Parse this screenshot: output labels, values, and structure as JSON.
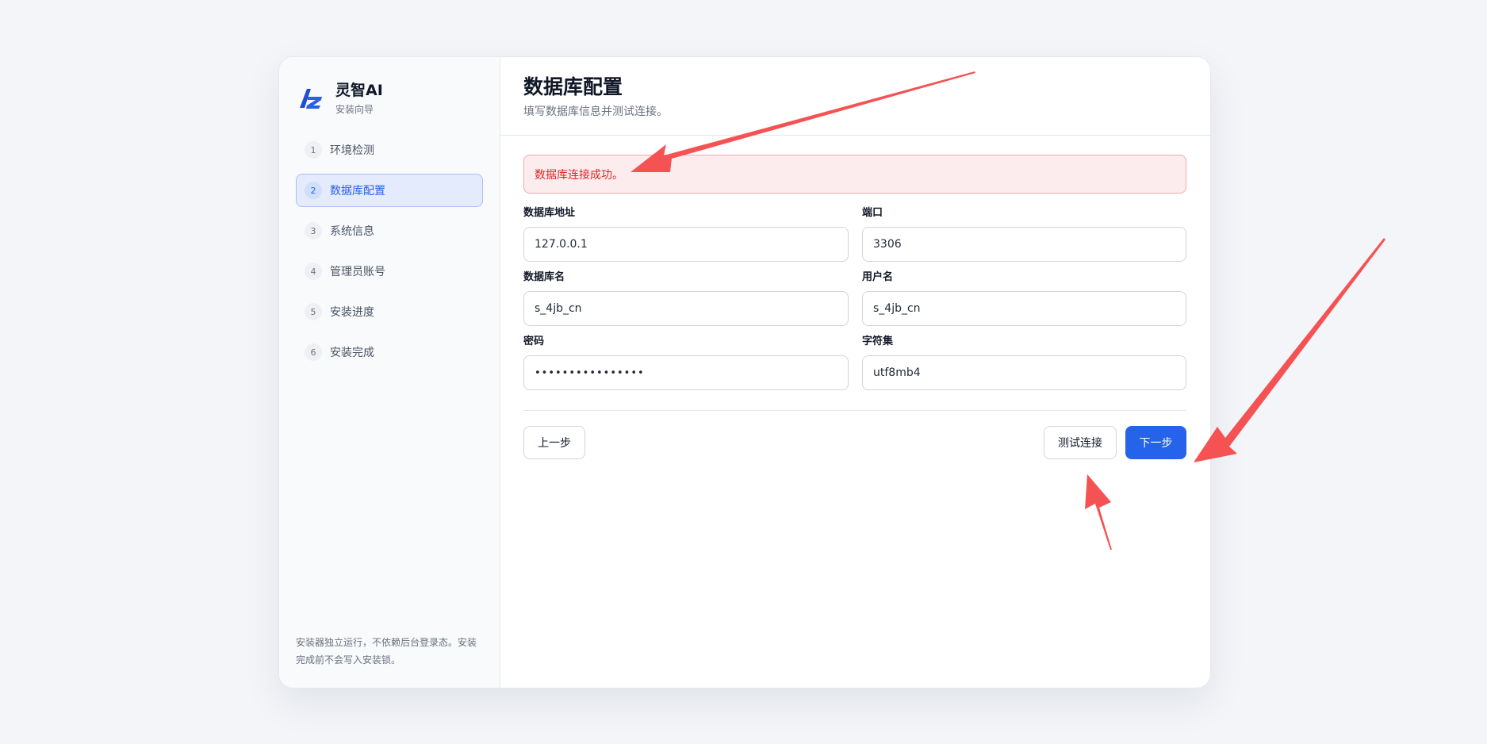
{
  "brand": {
    "name": "灵智AI",
    "subtitle": "安装向导",
    "logo_icon": "lz-logo-icon",
    "accent_color": "#2563eb"
  },
  "steps": [
    {
      "num": "1",
      "label": "环境检测"
    },
    {
      "num": "2",
      "label": "数据库配置"
    },
    {
      "num": "3",
      "label": "系统信息"
    },
    {
      "num": "4",
      "label": "管理员账号"
    },
    {
      "num": "5",
      "label": "安装进度"
    },
    {
      "num": "6",
      "label": "安装完成"
    }
  ],
  "sidebar_note": "安装器独立运行，不依赖后台登录态。安装完成前不会写入安装锁。",
  "header": {
    "title": "数据库配置",
    "subtitle": "填写数据库信息并测试连接。"
  },
  "alert": {
    "text": "数据库连接成功。",
    "color": "#dc2626"
  },
  "form": {
    "host": {
      "label": "数据库地址",
      "value": "127.0.0.1"
    },
    "port": {
      "label": "端口",
      "value": "3306"
    },
    "dbname": {
      "label": "数据库名",
      "value": "s_4jb_cn"
    },
    "username": {
      "label": "用户名",
      "value": "s_4jb_cn"
    },
    "password": {
      "label": "密码",
      "value": "••••••••••••••••"
    },
    "charset": {
      "label": "字符集",
      "value": "utf8mb4"
    }
  },
  "actions": {
    "prev_label": "上一步",
    "test_label": "测试连接",
    "next_label": "下一步"
  },
  "annotation_color": "#f55253"
}
